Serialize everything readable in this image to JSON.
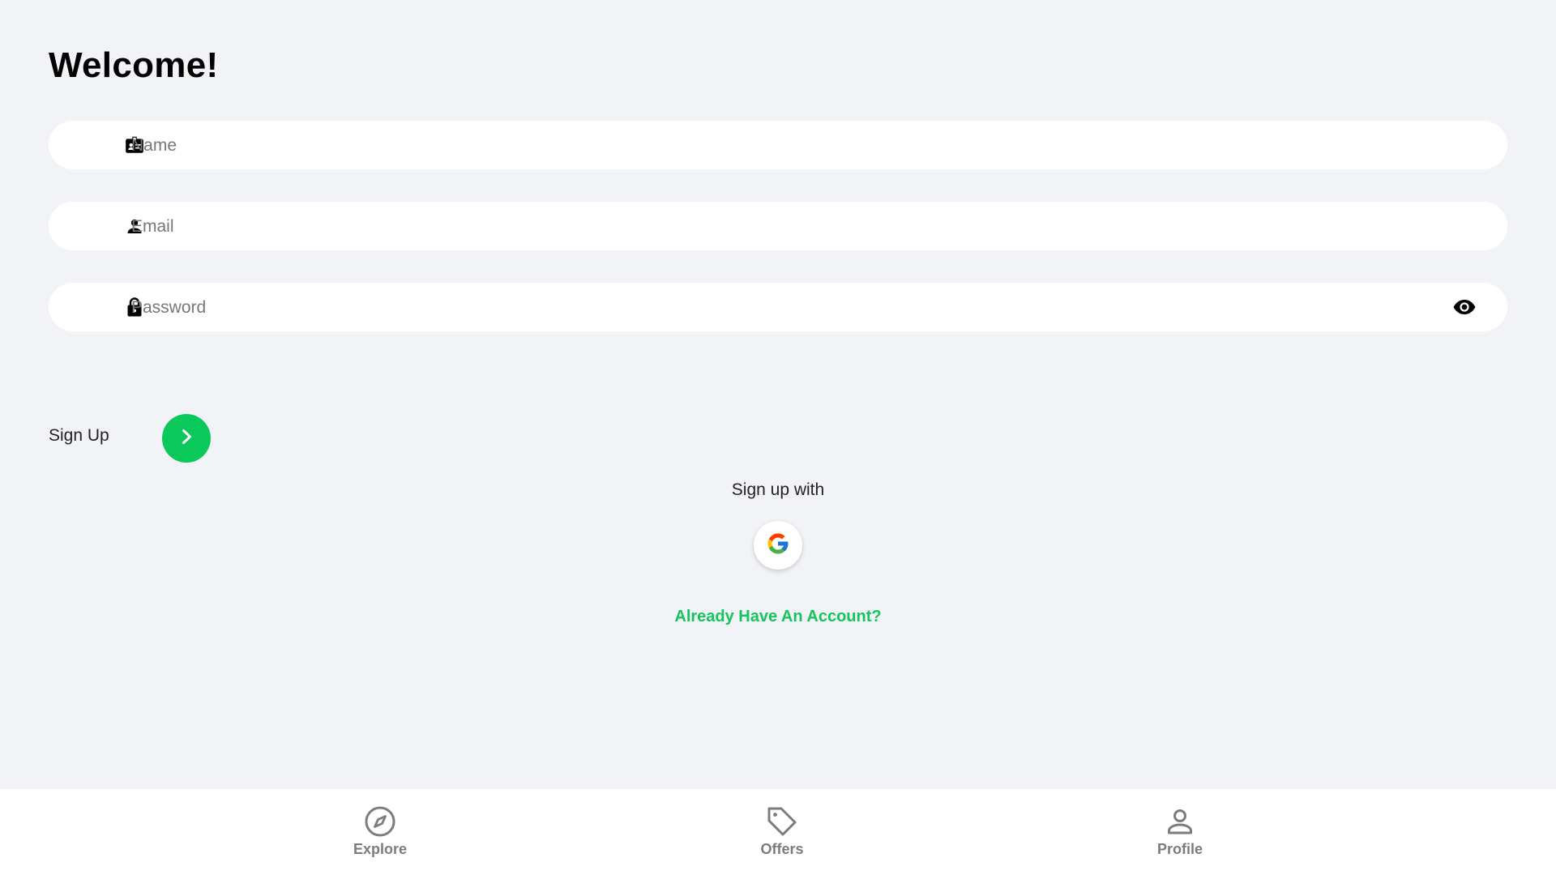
{
  "title": "Welcome!",
  "form": {
    "name_placeholder": "Name",
    "email_placeholder": "Email",
    "password_placeholder": "Password",
    "name_icon": "id-badge-icon",
    "email_icon": "user-icon",
    "password_icon": "lock-icon",
    "password_toggle_icon": "eye-icon"
  },
  "signup": {
    "label": "Sign Up",
    "button_icon": "chevron-right-icon",
    "social_label": "Sign up with",
    "social_provider_icon": "google-icon",
    "login_link": "Already Have An Account?"
  },
  "nav": {
    "items": [
      {
        "label": "Explore",
        "icon": "compass-icon"
      },
      {
        "label": "Offers",
        "icon": "tag-icon"
      },
      {
        "label": "Profile",
        "icon": "user-outline-icon"
      }
    ]
  },
  "colors": {
    "background": "#f2f3f7",
    "accent": "#0ac95a",
    "link": "#14c55d",
    "nav_text": "#7c7c7c"
  }
}
